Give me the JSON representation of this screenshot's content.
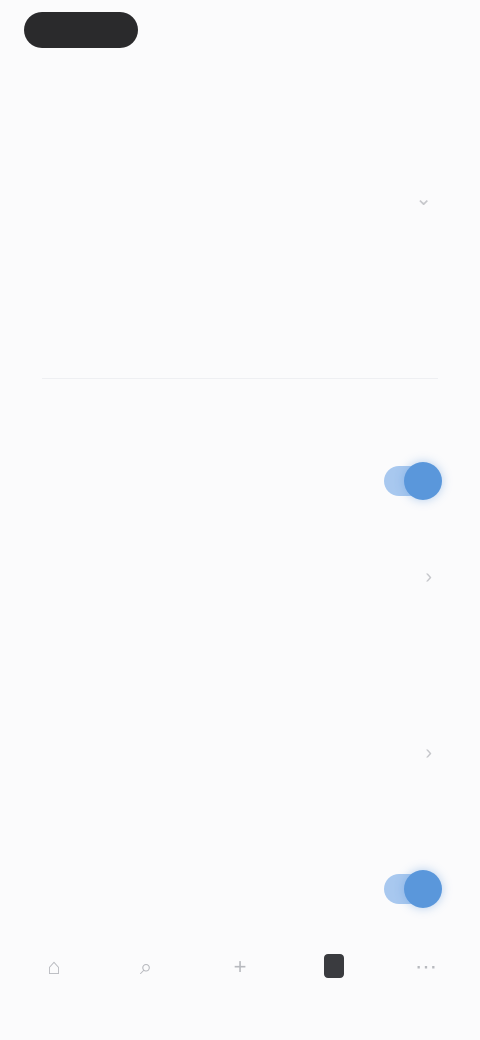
{
  "status_bar": {
    "time": "",
    "icons": ""
  },
  "header": {
    "title": ""
  },
  "sections": {
    "first": {
      "header": "",
      "rows": [
        {
          "title": "",
          "value": ""
        },
        {
          "title": "",
          "description": ""
        }
      ]
    },
    "second": {
      "rows": [
        {
          "title": "",
          "description": "",
          "toggle_on": true
        }
      ],
      "link": ""
    },
    "third": {
      "header": "",
      "rows": [
        {
          "title": "",
          "description": ""
        },
        {
          "title": "",
          "description": "",
          "toggle_on": true
        }
      ]
    }
  },
  "tab_bar": {
    "tabs": [
      {
        "label": "",
        "icon": "home-icon",
        "active": false
      },
      {
        "label": "",
        "icon": "search-icon",
        "active": false
      },
      {
        "label": "",
        "icon": "add-icon",
        "active": false
      },
      {
        "label": "",
        "icon": "device-icon",
        "active": true
      },
      {
        "label": "",
        "icon": "more-icon",
        "active": false
      }
    ]
  },
  "colors": {
    "accent": "#5a97db",
    "accent_light": "#a8c8ef",
    "background": "#fbfbfc"
  }
}
